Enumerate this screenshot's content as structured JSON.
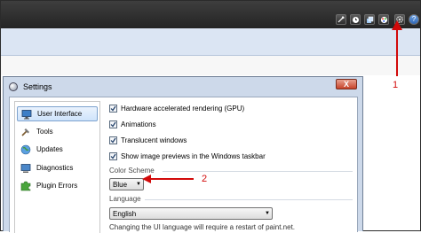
{
  "toolbar": {
    "icons": [
      "tool-icon",
      "clock-icon",
      "layers-icon",
      "palette-icon",
      "settings-gear-icon",
      "help-icon"
    ],
    "help_label": "?"
  },
  "settings_dialog": {
    "title": "Settings",
    "close_label": "X",
    "nav": [
      {
        "label": "User Interface",
        "icon": "monitor-icon",
        "selected": true
      },
      {
        "label": "Tools",
        "icon": "hammer-icon",
        "selected": false
      },
      {
        "label": "Updates",
        "icon": "globe-icon",
        "selected": false
      },
      {
        "label": "Diagnostics",
        "icon": "computer-icon",
        "selected": false
      },
      {
        "label": "Plugin Errors",
        "icon": "puzzle-icon",
        "selected": false
      }
    ],
    "options": [
      {
        "label": "Hardware accelerated rendering (GPU)",
        "checked": true
      },
      {
        "label": "Animations",
        "checked": true
      },
      {
        "label": "Translucent windows",
        "checked": true
      },
      {
        "label": "Show image previews in the Windows taskbar",
        "checked": true
      }
    ],
    "color_scheme": {
      "label": "Color Scheme",
      "value": "Blue"
    },
    "language": {
      "label": "Language",
      "value": "English",
      "note": "Changing the UI language will require a restart of paint.net."
    }
  },
  "annotations": {
    "callout_1": "1",
    "callout_2": "2",
    "color": "#d20a0a"
  }
}
